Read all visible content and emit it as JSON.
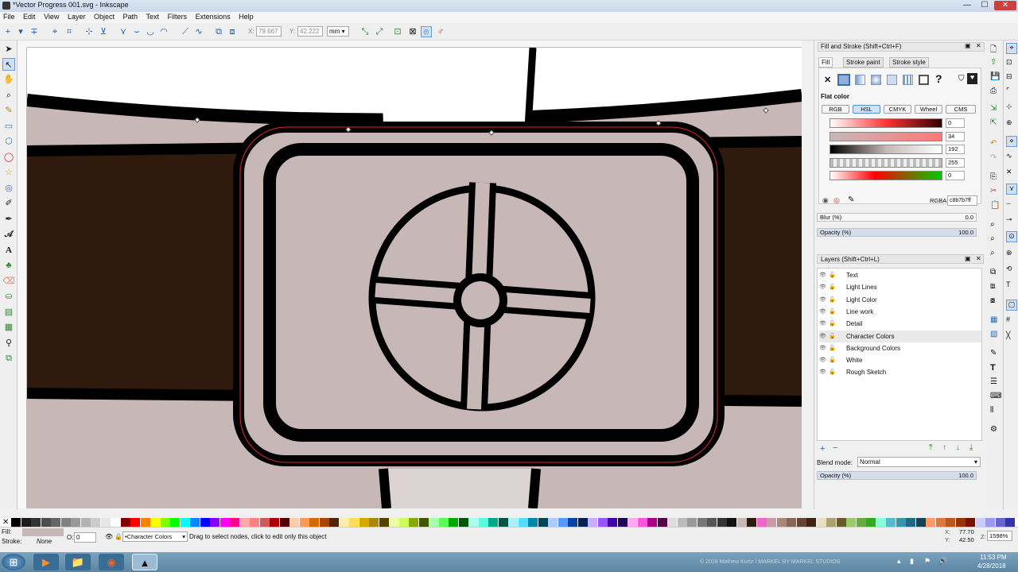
{
  "window": {
    "title": "*Vector Progress 001.svg - Inkscape",
    "min": "—",
    "max": "☐",
    "close": "✕"
  },
  "menu": [
    "File",
    "Edit",
    "View",
    "Layer",
    "Object",
    "Path",
    "Text",
    "Filters",
    "Extensions",
    "Help"
  ],
  "cmdbar": {
    "x_label": "X:",
    "x_value": "79.667",
    "y_label": "Y:",
    "y_value": "42.222",
    "unit": "mm"
  },
  "fill_stroke": {
    "title": "Fill and Stroke (Shift+Ctrl+F)",
    "tabs": [
      "Fill",
      "Stroke paint",
      "Stroke style"
    ],
    "paint_label": "Flat color",
    "modes": [
      "RGB",
      "HSL",
      "CMYK",
      "Wheel",
      "CMS"
    ],
    "active_mode": "HSL",
    "channels": [
      {
        "value": "0"
      },
      {
        "value": "34"
      },
      {
        "value": "192"
      },
      {
        "value": "255"
      },
      {
        "value": "0"
      }
    ],
    "rgba_label": "RGBA:",
    "rgba_value": "c8b7b7ff",
    "blur_label": "Blur (%)",
    "blur_value": "0.0",
    "opacity_label": "Opacity (%)",
    "opacity_value": "100.0",
    "opacity_level": 1.0
  },
  "layers_panel": {
    "title": "Layers (Shift+Ctrl+L)",
    "layers": [
      "Text",
      "Light Lines",
      "Light Color",
      "Line work",
      "Detail",
      "Character Colors",
      "Background Colors",
      "White",
      "Rough Sketch"
    ],
    "selected": "Character Colors",
    "blend_label": "Blend mode:",
    "blend_value": "Normal",
    "opacity_label": "Opacity (%)",
    "opacity_value": "100.0"
  },
  "status": {
    "fill_label": "Fill:",
    "stroke_label": "Stroke:",
    "stroke_value": "None",
    "o_label": "O:",
    "o_value": "0",
    "layer_value": "•Character Colors",
    "message": "Drag to select nodes, click to edit only this object",
    "x_label": "X:",
    "x_value": "77.70",
    "y_label": "Y:",
    "y_value": "42.50",
    "z_label": "Z:",
    "zoom": "1598%"
  },
  "taskbar": {
    "time": "11:53 PM",
    "date": "4/28/2018",
    "watermark": "© 2018 Mathew Kurtz / MARKEL BY MARKEL STUDIOS"
  },
  "colors": {
    "fill_swatch": "#c8b7b7",
    "belt": "#2f1a0d",
    "buckle": "#c8b7b7",
    "bg": "#c8b7b7",
    "outline": "#000000",
    "path_red": "#e0282a"
  }
}
